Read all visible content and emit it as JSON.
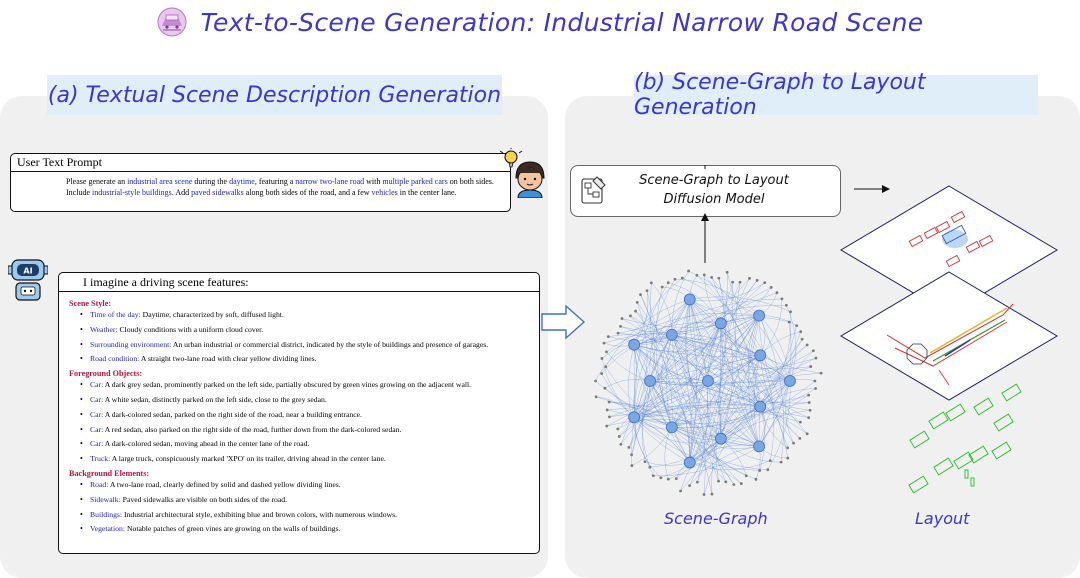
{
  "title": "Text-to-Scene Generation: Industrial Narrow Road Scene",
  "panel_a": {
    "heading": "(a) Textual Scene Description Generation",
    "prompt": {
      "title": "User Text Prompt",
      "line1_segments": [
        {
          "t": "Please generate an ",
          "h": false
        },
        {
          "t": "industrial area scene",
          "h": true
        },
        {
          "t": " during the ",
          "h": false
        },
        {
          "t": "daytime",
          "h": true
        },
        {
          "t": ", featuring a ",
          "h": false
        },
        {
          "t": "narrow two-lane road",
          "h": true
        },
        {
          "t": " with ",
          "h": false
        },
        {
          "t": "multiple parked cars",
          "h": true
        },
        {
          "t": " on both sides.",
          "h": false
        }
      ],
      "line2_segments": [
        {
          "t": "Include ",
          "h": false
        },
        {
          "t": "industrial-style buildings",
          "h": true
        },
        {
          "t": ". Add ",
          "h": false
        },
        {
          "t": "paved sidewalks",
          "h": true
        },
        {
          "t": " along both sides of the road, and a few ",
          "h": false
        },
        {
          "t": "vehicles",
          "h": true
        },
        {
          "t": " in the center lane.",
          "h": false
        }
      ]
    },
    "response": {
      "title": "I imagine a driving scene features:",
      "sections": [
        {
          "heading": "Scene Style:",
          "items": [
            {
              "key": "Time of the day:",
              "text": " Daytime, characterized by soft, diffused light."
            },
            {
              "key": "Weather:",
              "text": " Cloudy conditions with a uniform cloud cover."
            },
            {
              "key": "Surrounding environment:",
              "text": " An urban industrial or commercial district, indicated by the style of buildings and presence of garages."
            },
            {
              "key": "Road condition:",
              "text": " A straight two-lane road with clear yellow dividing lines."
            }
          ]
        },
        {
          "heading": "Foreground Objects:",
          "items": [
            {
              "key": "Car:",
              "text": " A dark grey sedan, prominently parked on the left side, partially obscured by green vines growing on the adjacent wall."
            },
            {
              "key": "Car:",
              "text": " A white sedan, distinctly parked on the left side, close to the grey sedan."
            },
            {
              "key": "Car:",
              "text": " A dark-colored sedan, parked on the right side of the road, near a building entrance."
            },
            {
              "key": "Car:",
              "text": " A red sedan, also parked on the right side of the road, further down from the dark-colored sedan."
            },
            {
              "key": "Car:",
              "text": " A dark-colored sedan, moving ahead in the center lane of the road."
            },
            {
              "key": "Truck:",
              "text": " A large truck, conspicuously marked 'XPO' on its trailer, driving ahead in the center lane."
            }
          ]
        },
        {
          "heading": "Background Elements:",
          "items": [
            {
              "key": "Road:",
              "text": " A two-lane road, clearly defined by solid and dashed yellow dividing lines."
            },
            {
              "key": "Sidewalk:",
              "text": " Paved sidewalks are visible on both sides of the road."
            },
            {
              "key": "Buildings:",
              "text": " Industrial architectural style, exhibiting blue and brown colors, with numerous windows."
            },
            {
              "key": "Vegetation:",
              "text": " Notable patches of green vines are growing on the walls of buildings."
            }
          ]
        }
      ]
    },
    "robot_badge": "AI"
  },
  "panel_b": {
    "heading": "(b) Scene-Graph to Layout Generation",
    "diffusion_label_line1": "Scene-Graph to Layout",
    "diffusion_label_line2": "Diffusion Model",
    "caption_scene_graph": "Scene-Graph",
    "caption_layout": "Layout"
  },
  "colors": {
    "accent": "#3b35d6",
    "highlight": "#1a1ad6",
    "section_heading": "#c2123e",
    "panel_bg": "#f0f0f1",
    "heading_bg": "#e0eef9",
    "graph_edge": "#4f7fd0",
    "layout_red": "#e03030",
    "layout_green": "#22c022"
  },
  "icons": [
    "scene-icon",
    "student-icon",
    "robot-icon",
    "arrow-right-icon",
    "diagram-icon"
  ]
}
